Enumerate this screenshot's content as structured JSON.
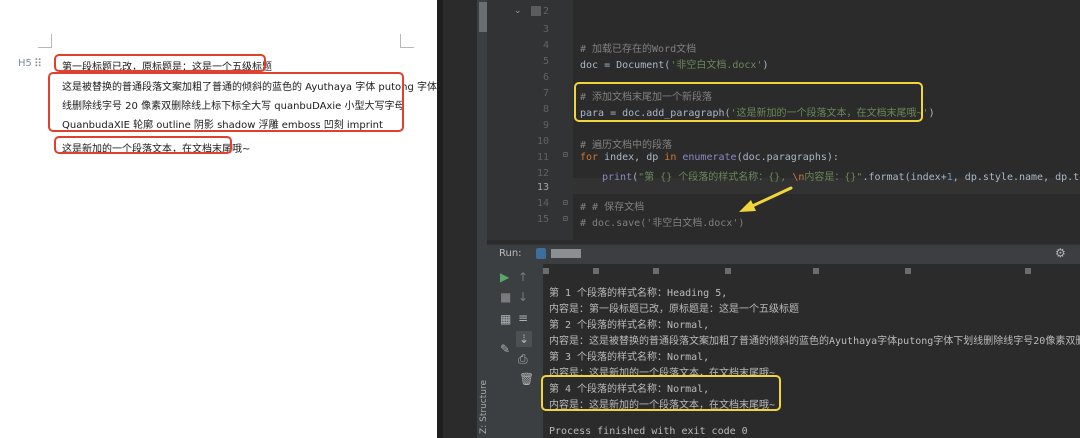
{
  "document": {
    "heading_marker": "H5",
    "drag_handle": "⠿",
    "heading_text": "第一段标题已改，原标题是：这是一个五级标题",
    "paragraph_lines": [
      "这是被替换的普通段落文案加粗了普通的倾斜的蓝色的 Ayuthaya 字体 putong 字体下划",
      "线删除线字号 20 像素双删除线上标下标全大写 quanbuDAxie 小型大写字母",
      "QuanbudaXIE 轮廓 outline 阴影 shadow 浮雕 emboss 凹刻 imprint"
    ],
    "new_paragraph": "这是新加的一个段落文本，在文档末尾哦~"
  },
  "editor": {
    "line_numbers": [
      "2",
      "3",
      "4",
      "5",
      "6",
      "7",
      "8",
      "9",
      "10",
      "11",
      "12",
      "13",
      "14",
      "15"
    ],
    "active_line": "13",
    "lines": {
      "l4_comment": "# 加载已存在的Word文档",
      "l5_a": "doc = Document(",
      "l5_str": "'非空白文档.docx'",
      "l5_b": ")",
      "l7_comment": "# 添加文档末尾加一个新段落",
      "l8_a": "para = doc.add_paragraph(",
      "l8_str": "'这是新加的一个段落文本，在文档末尾哦~'",
      "l8_b": ")",
      "l10_comment": "# 遍历文档中的段落",
      "l11_kw1": "for",
      "l11_a": " index, dp ",
      "l11_kw2": "in",
      "l11_sp": " ",
      "l11_fn": "enumerate",
      "l11_b": "(doc.paragraphs):",
      "l12_fn": "print",
      "l12_a": "(",
      "l12_str1": "\"第 {} 个段落的样式名称：{}, ",
      "l12_esc": "\\n",
      "l12_str2": "内容是：{}\"",
      "l12_b": ".format(index+",
      "l12_num": "1",
      "l12_c": ", dp.style.name, dp.text))",
      "l14_comment": "# # 保存文档",
      "l15_comment": "# doc.save('非空白文档.docx')"
    }
  },
  "run_panel": {
    "label": "Run:",
    "settings_icon": "gear-icon",
    "structure_label": "Z: Structure",
    "output": [
      "第 1 个段落的样式名称：Heading 5,",
      "内容是：第一段标题已改，原标题是：这是一个五级标题",
      "第 2 个段落的样式名称：Normal,",
      "内容是：这是被替换的普通段落文案加粗了普通的倾斜的蓝色的Ayuthaya字体putong字体下划线删除线字号20像素双删除线上",
      "第 3 个段落的样式名称：Normal,",
      "内容是：这是新加的一个段落文本，在文档末尾哦~",
      "第 4 个段落的样式名称：Normal,",
      "内容是：这是新加的一个段落文本，在文档末尾哦~"
    ],
    "exit_message": "Process finished with exit code 0"
  },
  "colors": {
    "highlight_red": "#e0412f",
    "highlight_yellow": "#f2d43c",
    "arrow_yellow": "#f2d43c"
  }
}
